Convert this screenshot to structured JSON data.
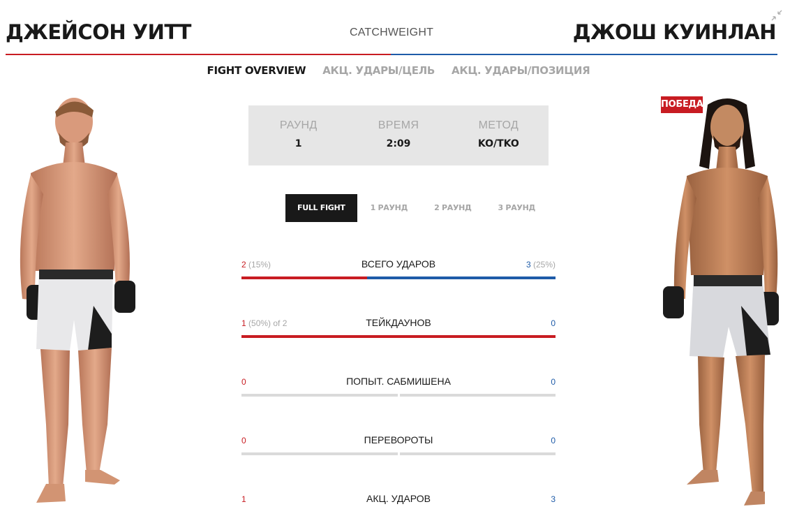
{
  "header": {
    "red_fighter": "ДЖЕЙСОН УИТТ",
    "blue_fighter": "ДЖОШ КУИНЛАН",
    "weight_class": "CATCHWEIGHT"
  },
  "tabs": [
    {
      "label": "FIGHT OVERVIEW",
      "active": true
    },
    {
      "label": "АКЦ. УДАРЫ/ЦЕЛЬ",
      "active": false
    },
    {
      "label": "АКЦ. УДАРЫ/ПОЗИЦИЯ",
      "active": false
    }
  ],
  "result": {
    "round_label": "РАУНД",
    "round_value": "1",
    "time_label": "ВРЕМЯ",
    "time_value": "2:09",
    "method_label": "МЕТОД",
    "method_value": "KO/TKO"
  },
  "round_tabs": [
    {
      "label": "FULL FIGHT",
      "active": true
    },
    {
      "label": "1 РАУНД",
      "active": false
    },
    {
      "label": "2 РАУНД",
      "active": false
    },
    {
      "label": "3 РАУНД",
      "active": false
    }
  ],
  "stats": [
    {
      "title": "ВСЕГО УДАРОВ",
      "red_value": "2",
      "red_extra": " (15%)",
      "blue_value": "3",
      "blue_extra": " (25%)",
      "red_share": 0.4
    },
    {
      "title": "ТЕЙКДАУНОВ",
      "red_value": "1",
      "red_extra": " (50%) of 2",
      "blue_value": "0",
      "blue_extra": "",
      "red_share": 1
    },
    {
      "title": "ПОПЫТ. САБМИШЕНА",
      "red_value": "0",
      "red_extra": "",
      "blue_value": "0",
      "blue_extra": "",
      "red_share": null
    },
    {
      "title": "ПЕРЕВОРОТЫ",
      "red_value": "0",
      "red_extra": "",
      "blue_value": "0",
      "blue_extra": "",
      "red_share": null
    },
    {
      "title": "АКЦ. УДАРОВ",
      "red_value": "1",
      "red_extra": "",
      "blue_value": "3",
      "blue_extra": "",
      "red_share": 0.25
    }
  ],
  "winner_badge": "ПОБЕДА",
  "colors": {
    "red": "#c81c22",
    "blue": "#1e5ba8"
  },
  "icons": {
    "collapse": "collapse-icon"
  }
}
